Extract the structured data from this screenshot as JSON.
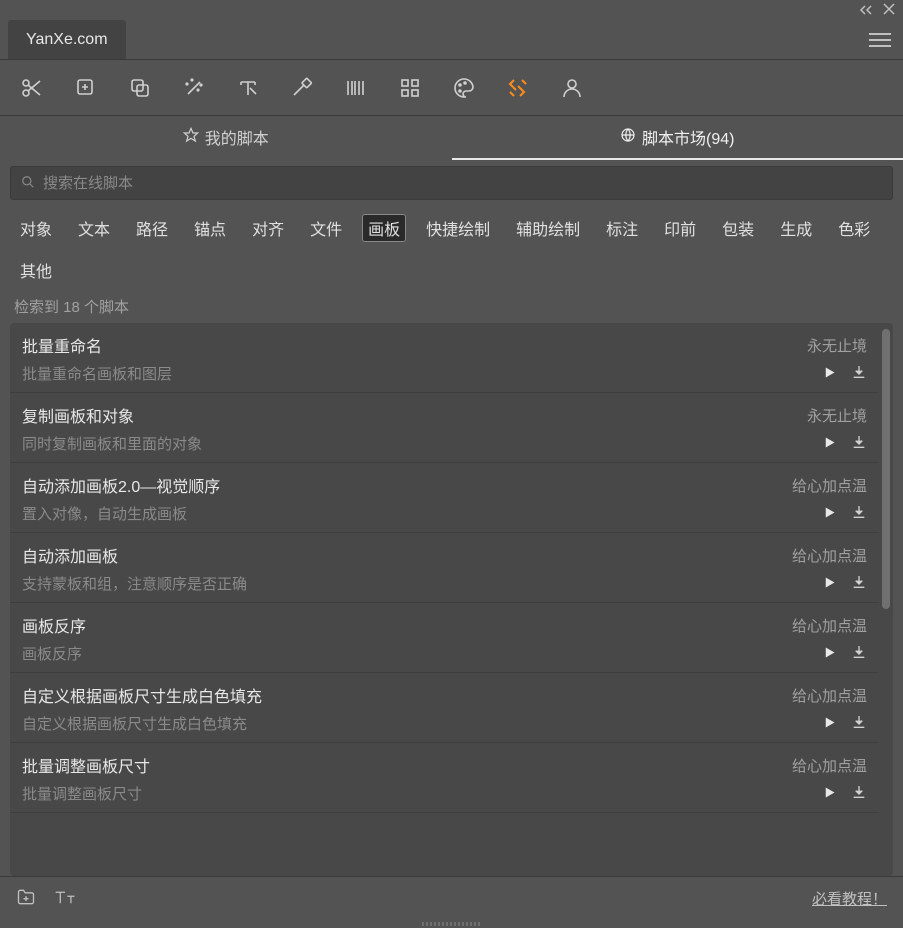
{
  "app": {
    "title": "YanXe.com"
  },
  "tabs": {
    "myScripts": "我的脚本",
    "market": "脚本市场(94)"
  },
  "search": {
    "placeholder": "搜索在线脚本"
  },
  "filters": [
    "对象",
    "文本",
    "路径",
    "锚点",
    "对齐",
    "文件",
    "画板",
    "快捷绘制",
    "辅助绘制",
    "标注",
    "印前",
    "包装",
    "生成",
    "色彩",
    "其他"
  ],
  "activeFilter": "画板",
  "resultCount": "检索到 18 个脚本",
  "scripts": [
    {
      "title": "批量重命名",
      "desc": "批量重命名画板和图层",
      "author": "永无止境"
    },
    {
      "title": "复制画板和对象",
      "desc": "同时复制画板和里面的对象",
      "author": "永无止境"
    },
    {
      "title": "自动添加画板2.0—视觉顺序",
      "desc": "置入对像，自动生成画板",
      "author": "给心加点温"
    },
    {
      "title": "自动添加画板",
      "desc": "支持蒙板和组，注意顺序是否正确",
      "author": "给心加点温"
    },
    {
      "title": "画板反序",
      "desc": "画板反序",
      "author": "给心加点温"
    },
    {
      "title": "自定义根据画板尺寸生成白色填充",
      "desc": "自定义根据画板尺寸生成白色填充",
      "author": "给心加点温"
    },
    {
      "title": "批量调整画板尺寸",
      "desc": "批量调整画板尺寸",
      "author": "给心加点温"
    }
  ],
  "footer": {
    "tutorial": "必看教程！"
  }
}
